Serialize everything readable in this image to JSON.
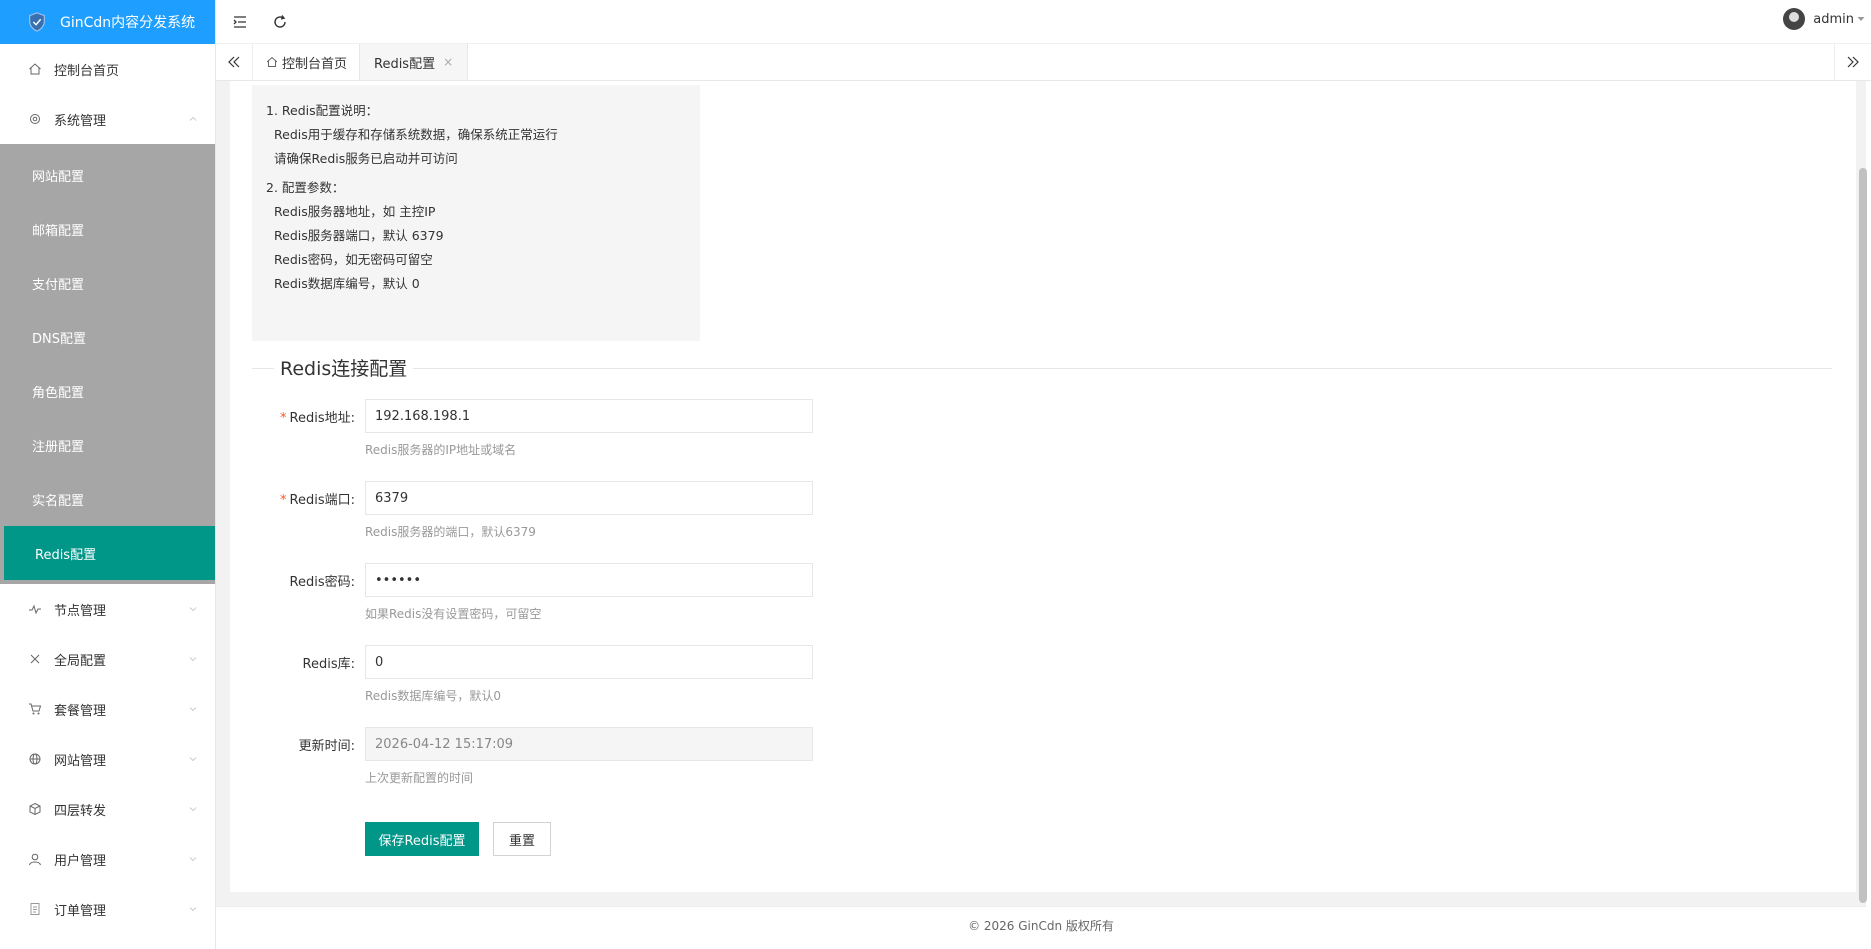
{
  "app": {
    "title": "GinCdn内容分发系统"
  },
  "sidebar": {
    "top_items": [
      {
        "label": "控制台首页",
        "icon": "home-icon"
      },
      {
        "label": "系统管理",
        "icon": "gear-icon"
      }
    ],
    "submenu": [
      {
        "label": "网站配置"
      },
      {
        "label": "邮箱配置"
      },
      {
        "label": "支付配置"
      },
      {
        "label": "DNS配置"
      },
      {
        "label": "角色配置"
      },
      {
        "label": "注册配置"
      },
      {
        "label": "实名配置"
      },
      {
        "label": "Redis配置",
        "active": true
      }
    ],
    "bottom_items": [
      {
        "label": "节点管理",
        "icon": "pulse-icon"
      },
      {
        "label": "全局配置",
        "icon": "tools-icon"
      },
      {
        "label": "套餐管理",
        "icon": "cart-icon"
      },
      {
        "label": "网站管理",
        "icon": "globe-icon"
      },
      {
        "label": "四层转发",
        "icon": "cube-icon"
      },
      {
        "label": "用户管理",
        "icon": "user-icon"
      },
      {
        "label": "订单管理",
        "icon": "document-icon"
      }
    ]
  },
  "header": {
    "user": "admin"
  },
  "tabs": [
    {
      "label": "控制台首页"
    },
    {
      "label": "Redis配置",
      "active": true
    }
  ],
  "notice": {
    "lines": [
      "1. Redis配置说明：",
      "Redis用于缓存和存储系统数据，确保系统正常运行",
      "请确保Redis服务已启动并可访问",
      "2. 配置参数：",
      "Redis服务器地址，如 主控IP",
      "Redis服务器端口，默认 6379",
      "Redis密码，如无密码可留空",
      "Redis数据库编号，默认 0"
    ]
  },
  "form": {
    "legend": "Redis连接配置",
    "fields": [
      {
        "label": "Redis地址:",
        "required": true,
        "value": "192.168.198.1",
        "hint": "Redis服务器的IP地址或域名"
      },
      {
        "label": "Redis端口:",
        "required": true,
        "value": "6379",
        "hint": "Redis服务器的端口，默认6379"
      },
      {
        "label": "Redis密码:",
        "required": false,
        "value": "••••••",
        "hint": "如果Redis没有设置密码，可留空"
      },
      {
        "label": "Redis库:",
        "required": false,
        "value": "0",
        "hint": "Redis数据库编号，默认0"
      },
      {
        "label": "更新时间:",
        "required": false,
        "value": "2026-04-12 15:17:09",
        "hint": "上次更新配置的时间",
        "disabled": true
      }
    ],
    "save_label": "保存Redis配置",
    "reset_label": "重置"
  },
  "footer": {
    "text": "© 2026 GinCdn 版权所有"
  },
  "colors": {
    "brand": "#1e9fff",
    "primary": "#009688",
    "submenu_bg": "#a6a6a6",
    "required": "#ff5722"
  }
}
